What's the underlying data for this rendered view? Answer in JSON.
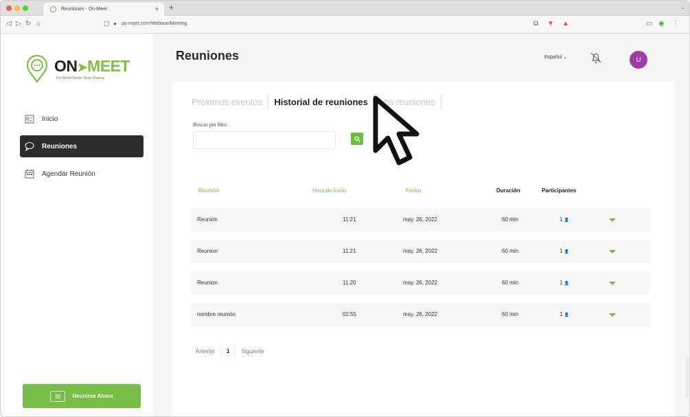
{
  "browser": {
    "tab_title": "Reuniones - On-Meet",
    "url": "on-meet.com/Webinar/Meeting"
  },
  "logo": {
    "on": "ON",
    "meet": "MEET",
    "slogan": "The World Needs Team Sharing"
  },
  "sidebar": {
    "items": [
      {
        "label": "Inicio",
        "icon": "home-icon"
      },
      {
        "label": "Reuniones",
        "icon": "chat-icon"
      },
      {
        "label": "Agendar Reunión",
        "icon": "calendar-icon"
      }
    ],
    "meet_now": "Reunirse Ahora"
  },
  "header": {
    "title": "Reuniones",
    "language": "Español"
  },
  "tabs": [
    "Próximos eventos",
    "Historial de reuniones",
    "Mis reuniones"
  ],
  "filter": {
    "label": "Buscar por filtro",
    "value": ""
  },
  "table": {
    "headers": [
      "Reunión",
      "Hora de Inicio",
      "Fecha",
      "Duración",
      "Participantes"
    ],
    "rows": [
      {
        "name": "Reunión",
        "time": "11:21",
        "date": "may. 26, 2022",
        "duration": "60 min",
        "participants": "1"
      },
      {
        "name": "Reunion",
        "time": "11:21",
        "date": "may. 26, 2022",
        "duration": "60 min",
        "participants": "1"
      },
      {
        "name": "Reunion",
        "time": "11:20",
        "date": "may. 26, 2022",
        "duration": "60 min",
        "participants": "1"
      },
      {
        "name": "nombre reunión",
        "time": "02:55",
        "date": "may. 26, 2022",
        "duration": "60 min",
        "participants": "1"
      }
    ]
  },
  "pagination": {
    "prev": "Anterior",
    "page": "1",
    "next": "Siguiente"
  },
  "colors": {
    "brand_green": "#7cbe48",
    "avatar": "#a23aa6",
    "active_nav": "#2b2b2b"
  },
  "user": {
    "initial": "U"
  }
}
